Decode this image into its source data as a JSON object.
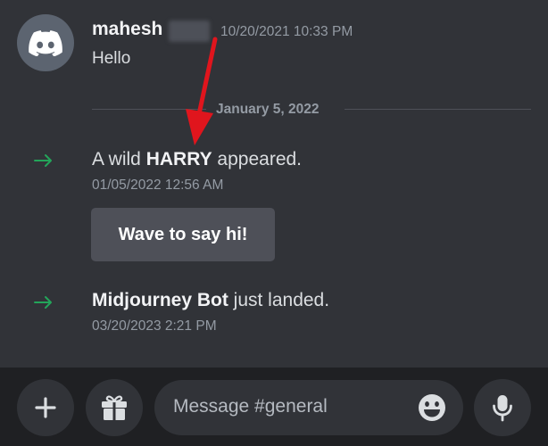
{
  "message": {
    "author": "mahesh",
    "timestamp": "10/20/2021 10:33 PM",
    "text": "Hello"
  },
  "date_divider": "January 5, 2022",
  "system_messages": [
    {
      "prefix": "A wild ",
      "name": "HARRY",
      "suffix": " appeared.",
      "timestamp": "01/05/2022 12:56 AM"
    },
    {
      "prefix": "",
      "name": "Midjourney Bot",
      "suffix": " just landed.",
      "timestamp": "03/20/2023 2:21 PM"
    }
  ],
  "wave_button": "Wave to say hi!",
  "composer": {
    "placeholder": "Message #general"
  },
  "icons": {
    "avatar": "discord-logo-icon",
    "join_arrow": "arrow-right-icon",
    "add": "plus-icon",
    "gift": "gift-icon",
    "emoji": "emoji-icon",
    "mic": "microphone-icon",
    "annotation": "red-arrow-icon"
  },
  "colors": {
    "background": "#313338",
    "composer_bar": "#1f2023",
    "join_arrow": "#23a55a",
    "annotation_arrow": "#e0151d"
  }
}
